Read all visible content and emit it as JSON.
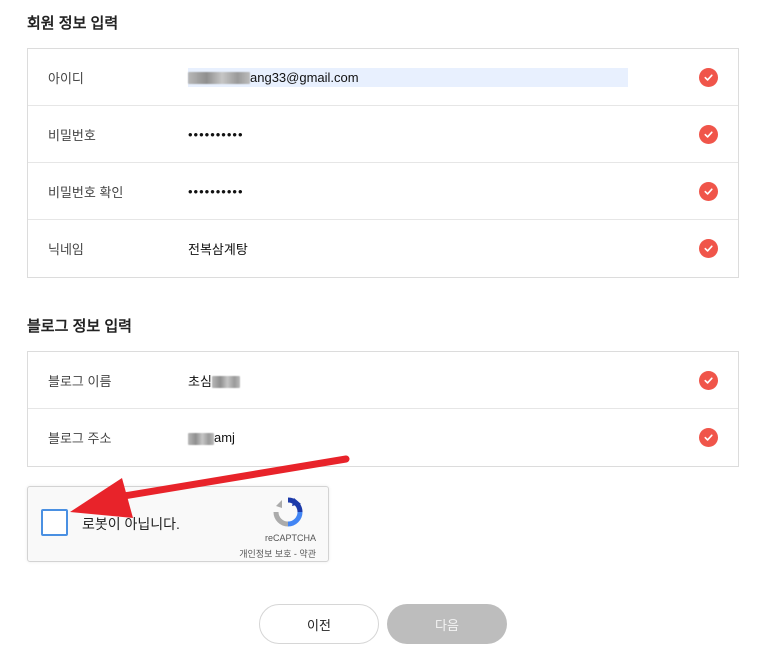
{
  "member_section": {
    "title": "회원 정보 입력",
    "rows": [
      {
        "label": "아이디",
        "value": "ang33@gmail.com"
      },
      {
        "label": "비밀번호",
        "value": "••••••••••"
      },
      {
        "label": "비밀번호 확인",
        "value": "••••••••••"
      },
      {
        "label": "닉네임",
        "value": "전복삼계탕"
      }
    ]
  },
  "blog_section": {
    "title": "블로그 정보 입력",
    "rows": [
      {
        "label": "블로그 이름",
        "value_prefix": "초심"
      },
      {
        "label": "블로그 주소",
        "value_suffix": "amj"
      }
    ]
  },
  "captcha": {
    "label": "로봇이 아닙니다.",
    "brand": "reCAPTCHA",
    "links": "개인정보 보호 - 약관"
  },
  "buttons": {
    "prev": "이전",
    "next": "다음"
  },
  "colors": {
    "check": "#f0554a",
    "arrow": "#e8232a",
    "next_button": "#bdbdbd"
  }
}
